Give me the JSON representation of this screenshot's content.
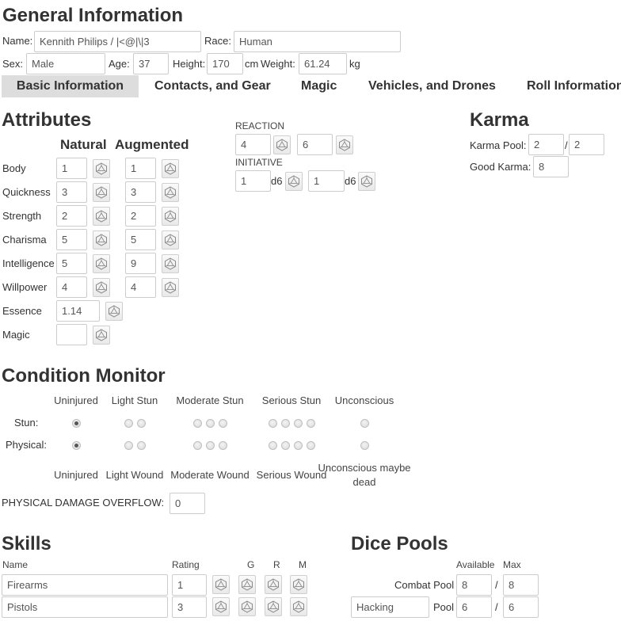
{
  "header": {
    "title": "General Information",
    "name_label": "Name:",
    "name_value": "Kennith Philips / |<@|\\|3",
    "race_label": "Race:",
    "race_value": "Human",
    "sex_label": "Sex:",
    "sex_value": "Male",
    "age_label": "Age:",
    "age_value": "37",
    "height_label": "Height:",
    "height_value": "170",
    "cm_label": "cm",
    "weight_label": "Weight:",
    "weight_value": "61.24",
    "kg_label": "kg"
  },
  "tabs": [
    {
      "label": "Basic Information",
      "active": true
    },
    {
      "label": "Contacts, and Gear",
      "active": false
    },
    {
      "label": "Magic",
      "active": false
    },
    {
      "label": "Vehicles, and Drones",
      "active": false
    },
    {
      "label": "Roll Information",
      "active": false
    }
  ],
  "attributes": {
    "title": "Attributes",
    "natural_header": "Natural",
    "augmented_header": "Augmented",
    "rows": [
      {
        "label": "Body",
        "natural": "1",
        "augmented": "1"
      },
      {
        "label": "Quickness",
        "natural": "3",
        "augmented": "3"
      },
      {
        "label": "Strength",
        "natural": "2",
        "augmented": "2"
      },
      {
        "label": "Charisma",
        "natural": "5",
        "augmented": "5"
      },
      {
        "label": "Intelligence",
        "natural": "5",
        "augmented": "9"
      },
      {
        "label": "Willpower",
        "natural": "4",
        "augmented": "4"
      }
    ],
    "essence_label": "Essence",
    "essence_value": "1.14",
    "magic_label": "Magic",
    "magic_value": ""
  },
  "reaction": {
    "label": "REACTION",
    "natural": "4",
    "augmented": "6",
    "initiative_label": "INITIATIVE",
    "init_dice_1": "1",
    "d6_1": "d6",
    "init_dice_2": "1",
    "d6_2": "d6"
  },
  "karma": {
    "title": "Karma",
    "pool_label": "Karma Pool:",
    "pool_value": "2",
    "slash": "/",
    "pool_max": "2",
    "good_label": "Good Karma:",
    "good_value": "8"
  },
  "condition": {
    "title": "Condition Monitor",
    "stun_headers": [
      "Uninjured",
      "Light Stun",
      "Moderate Stun",
      "Serious Stun",
      "Unconscious"
    ],
    "physical_headers": [
      "Uninjured",
      "Light Wound",
      "Moderate Wound",
      "Serious Wound",
      "Unconscious maybe dead"
    ],
    "stun_label": "Stun:",
    "physical_label": "Physical:",
    "stun_level": 0,
    "physical_level": 0,
    "overflow_label": "PHYSICAL DAMAGE OVERFLOW:",
    "overflow_value": "0"
  },
  "skills": {
    "title": "Skills",
    "col_name": "Name",
    "col_rating": "Rating",
    "col_g": "G",
    "col_r": "R",
    "col_m": "M",
    "rows": [
      {
        "name": "Firearms",
        "rating": "1"
      },
      {
        "name": "Pistols",
        "rating": "3"
      }
    ]
  },
  "dice_pools": {
    "title": "Dice Pools",
    "col_available": "Available",
    "col_max": "Max",
    "combat_label": "Combat Pool",
    "combat_available": "8",
    "combat_max": "8",
    "slash": "/",
    "custom_name": "Hacking",
    "pool_label": "Pool",
    "custom_available": "6",
    "custom_max": "6"
  },
  "icons": {
    "roll": "dice-icon"
  }
}
